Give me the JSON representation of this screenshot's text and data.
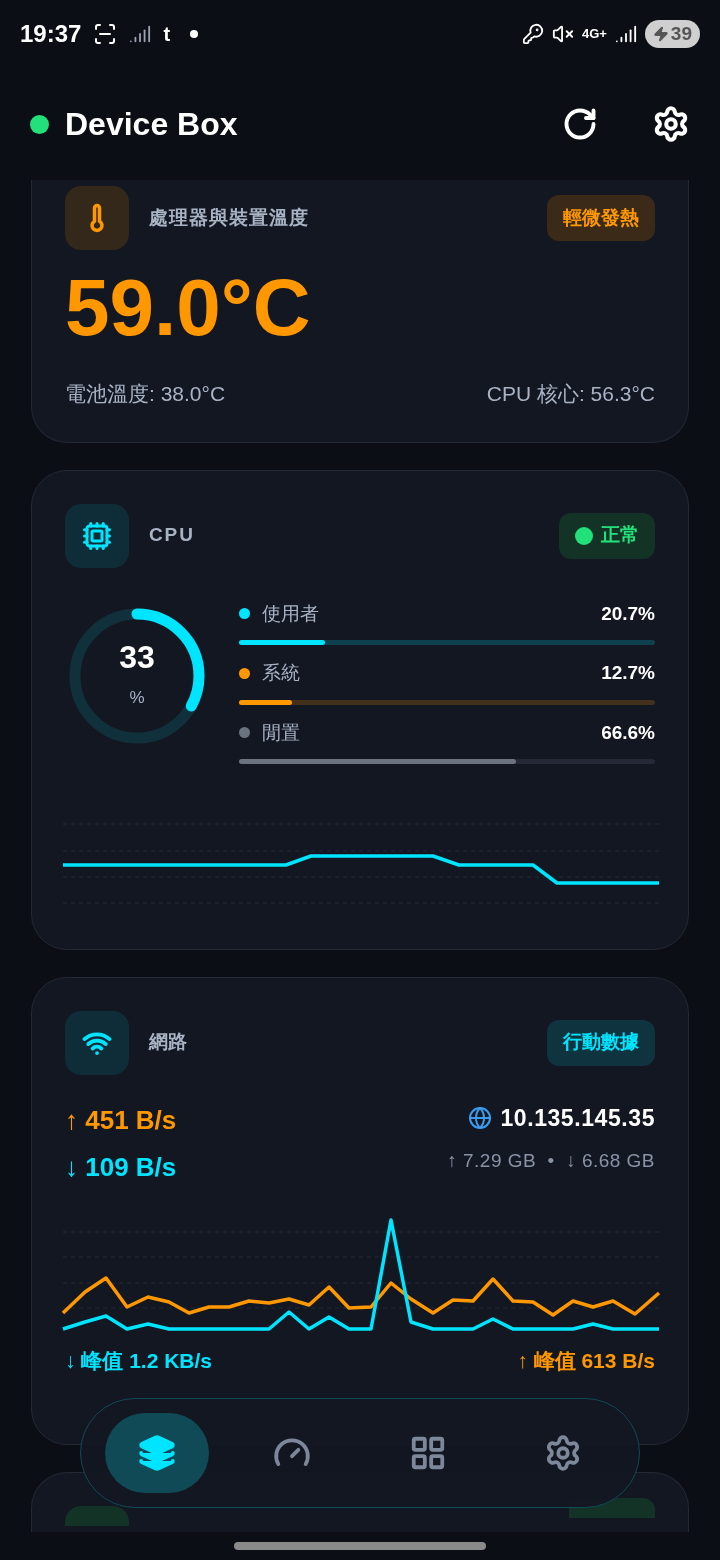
{
  "status_bar": {
    "time": "19:37",
    "app_letter": "t",
    "network": "4G+",
    "battery": "39"
  },
  "header": {
    "title": "Device Box",
    "online": true
  },
  "temperature": {
    "title": "處理器與裝置溫度",
    "badge": {
      "label": "輕微發熱",
      "kind": "warm"
    },
    "value": "59.0°C",
    "battery": "電池溫度: 38.0°C",
    "cpu_core": "CPU 核心: 56.3°C"
  },
  "cpu": {
    "title": "CPU",
    "badge": {
      "label": "正常",
      "kind": "normal"
    },
    "total": "33",
    "unit": "%",
    "level": 0.33,
    "breakdown": [
      {
        "label": "使用者",
        "value": "20.7%",
        "level": 0.207,
        "color": "#00e5ff"
      },
      {
        "label": "系統",
        "value": "12.7%",
        "level": 0.127,
        "color": "#ff9800"
      },
      {
        "label": "閒置",
        "value": "66.6%",
        "level": 0.666,
        "color": "#6b7280"
      }
    ]
  },
  "network": {
    "title": "網路",
    "badge": {
      "label": "行動數據",
      "kind": "info"
    },
    "upload": "↑ 451 B/s",
    "download": "↓ 109 B/s",
    "ip": "10.135.145.35",
    "totals": "↑ 7.29 GB  •  ↓ 6.68 GB",
    "peak_down": "↓ 峰值 1.2 KB/s",
    "peak_up": "↑ 峰值 613 B/s"
  },
  "nav": [
    {
      "kind": "layers",
      "selected": true
    },
    {
      "kind": "gauge",
      "selected": false
    },
    {
      "kind": "grid",
      "selected": false
    },
    {
      "kind": "settings",
      "selected": false
    }
  ]
}
